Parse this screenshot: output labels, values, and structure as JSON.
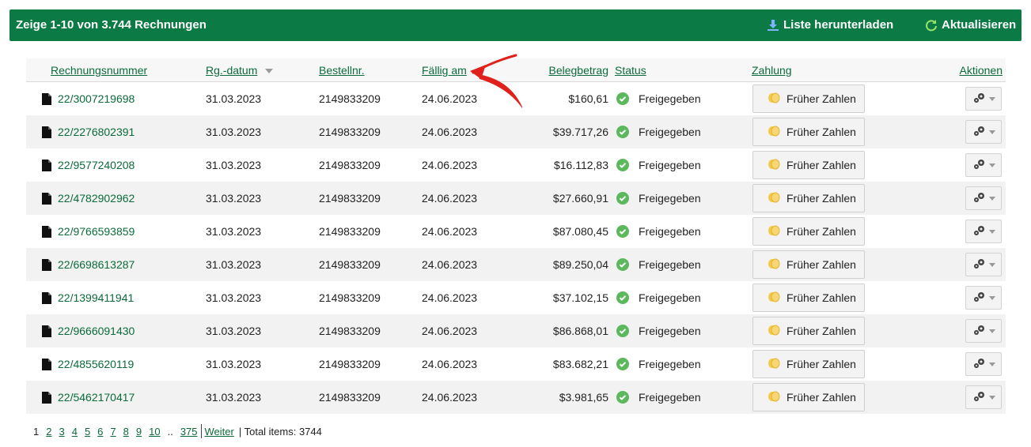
{
  "header": {
    "title": "Zeige 1-10 von 3.744 Rechnungen",
    "download_label": "Liste herunterladen",
    "refresh_label": "Aktualisieren",
    "bg_color": "#0b7a45"
  },
  "columns": {
    "invoice_number": "Rechnungsnummer",
    "invoice_date": "Rg.-datum",
    "order_number": "Bestellnr.",
    "due_date": "Fällig am",
    "amount": "Belegbetrag",
    "status": "Status",
    "payment": "Zahlung",
    "actions": "Aktionen"
  },
  "rows": [
    {
      "invoice": "22/3007219698",
      "date": "31.03.2023",
      "order": "2149833209",
      "due": "24.06.2023",
      "amount": "$160,61",
      "status": "Freigegeben",
      "pay": "Früher Zahlen"
    },
    {
      "invoice": "22/2276802391",
      "date": "31.03.2023",
      "order": "2149833209",
      "due": "24.06.2023",
      "amount": "$39.717,26",
      "status": "Freigegeben",
      "pay": "Früher Zahlen"
    },
    {
      "invoice": "22/9577240208",
      "date": "31.03.2023",
      "order": "2149833209",
      "due": "24.06.2023",
      "amount": "$16.112,83",
      "status": "Freigegeben",
      "pay": "Früher Zahlen"
    },
    {
      "invoice": "22/4782902962",
      "date": "31.03.2023",
      "order": "2149833209",
      "due": "24.06.2023",
      "amount": "$27.660,91",
      "status": "Freigegeben",
      "pay": "Früher Zahlen"
    },
    {
      "invoice": "22/9766593859",
      "date": "31.03.2023",
      "order": "2149833209",
      "due": "24.06.2023",
      "amount": "$87.080,45",
      "status": "Freigegeben",
      "pay": "Früher Zahlen"
    },
    {
      "invoice": "22/6698613287",
      "date": "31.03.2023",
      "order": "2149833209",
      "due": "24.06.2023",
      "amount": "$89.250,04",
      "status": "Freigegeben",
      "pay": "Früher Zahlen"
    },
    {
      "invoice": "22/1399411941",
      "date": "31.03.2023",
      "order": "2149833209",
      "due": "24.06.2023",
      "amount": "$37.102,15",
      "status": "Freigegeben",
      "pay": "Früher Zahlen"
    },
    {
      "invoice": "22/9666091430",
      "date": "31.03.2023",
      "order": "2149833209",
      "due": "24.06.2023",
      "amount": "$86.868,01",
      "status": "Freigegeben",
      "pay": "Früher Zahlen"
    },
    {
      "invoice": "22/4855620119",
      "date": "31.03.2023",
      "order": "2149833209",
      "due": "24.06.2023",
      "amount": "$83.682,21",
      "status": "Freigegeben",
      "pay": "Früher Zahlen"
    },
    {
      "invoice": "22/5462170417",
      "date": "31.03.2023",
      "order": "2149833209",
      "due": "24.06.2023",
      "amount": "$3.981,65",
      "status": "Freigegeben",
      "pay": "Früher Zahlen"
    }
  ],
  "pagination": {
    "current": "1",
    "pages": [
      "2",
      "3",
      "4",
      "5",
      "6",
      "7",
      "8",
      "9",
      "10"
    ],
    "ellipsis": "..",
    "last": "375",
    "next_label": "Weiter",
    "total_text": "| Total items: 3744"
  },
  "colors": {
    "link_green": "#0b6b3a",
    "status_green": "#5cb85c",
    "coin_yellow": "#f4c84a",
    "annotation_red": "#e0201b"
  }
}
